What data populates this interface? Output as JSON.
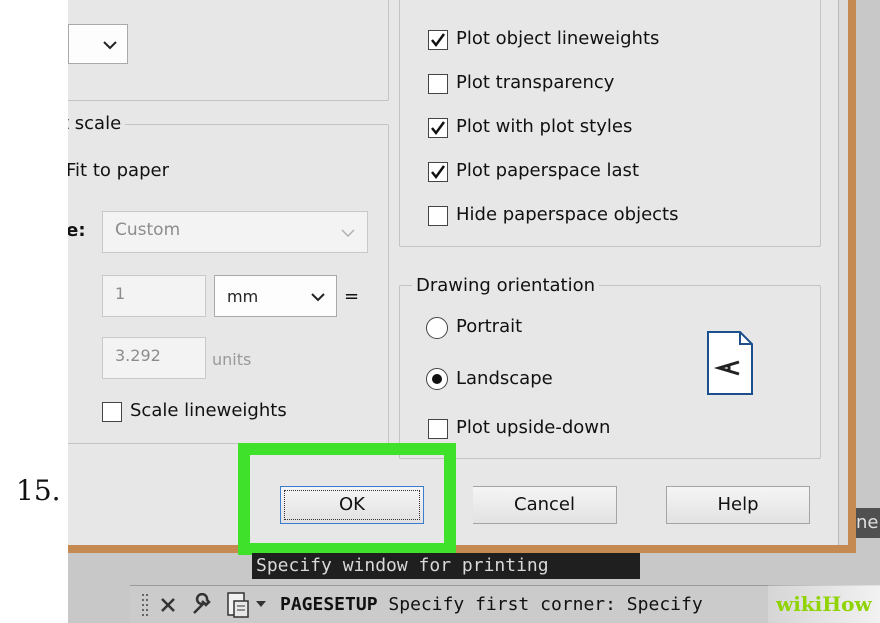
{
  "step_number": "15.",
  "plot_options": {
    "items": [
      {
        "label": "Plot object lineweights",
        "checked": true
      },
      {
        "label": "Plot transparency",
        "checked": false
      },
      {
        "label": "Plot with plot styles",
        "checked": true
      },
      {
        "label": "Plot paperspace last",
        "checked": true
      },
      {
        "label": "Hide paperspace objects",
        "checked": false
      }
    ]
  },
  "plot_scale": {
    "title": "t scale",
    "fit_to_paper": "Fit to paper",
    "scale_label": "le:",
    "scale_value": "Custom",
    "value1": "1",
    "unit1": "mm",
    "equals": "=",
    "value2": "3.292",
    "unit2": "units",
    "scale_lineweights": "Scale lineweights"
  },
  "drawing_orientation": {
    "title": "Drawing orientation",
    "portrait": "Portrait",
    "landscape": "Landscape",
    "upside_down": "Plot upside-down",
    "selected": "landscape",
    "icon_letter": "A"
  },
  "buttons": {
    "ok": "OK",
    "cancel": "Cancel",
    "help": "Help"
  },
  "command": {
    "tooltip": "Specify window for printing",
    "line_name": "PAGESETUP",
    "line_text": "Specify first corner: Specify",
    "right_stub": "ne"
  },
  "watermark": "wikiHow",
  "colors": {
    "highlight": "#3fe12a",
    "frame": "#c48a52",
    "dialog_bg": "#e7e7e8"
  }
}
